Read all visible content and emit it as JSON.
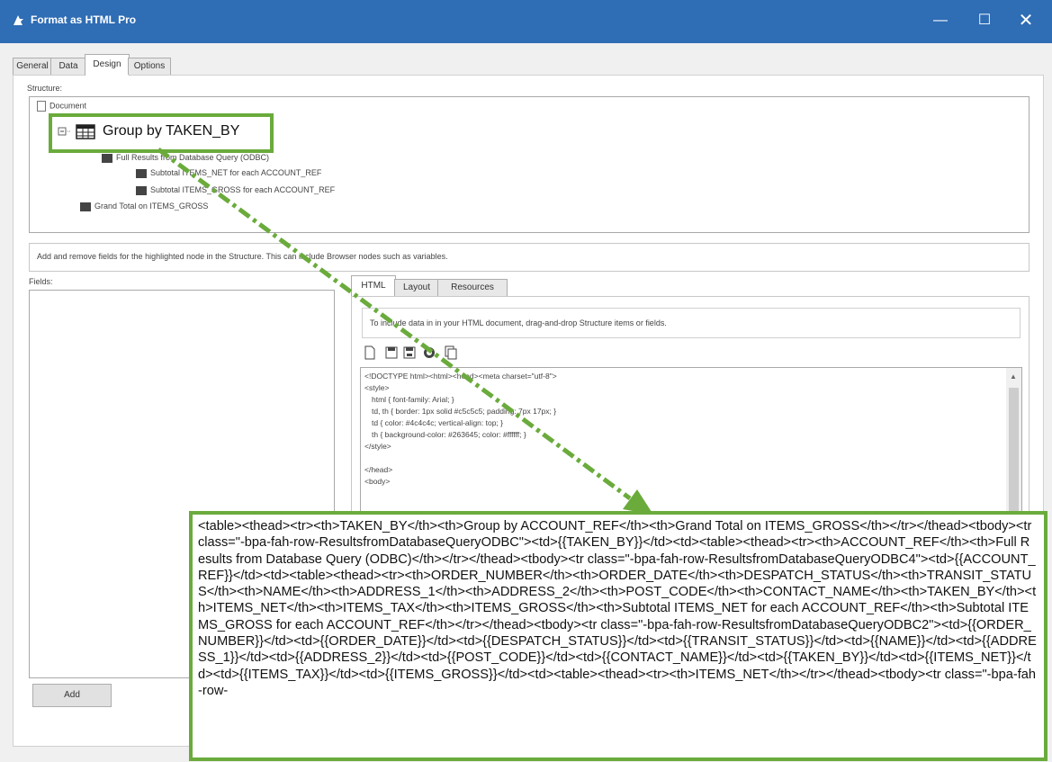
{
  "window": {
    "title": "Format as HTML Pro",
    "minimize": "—",
    "maximize": "☐",
    "close": "✕"
  },
  "tabs": [
    {
      "label": "General"
    },
    {
      "label": "Data"
    },
    {
      "label": "Design"
    },
    {
      "label": "Options"
    }
  ],
  "structure": {
    "label": "Structure:",
    "document": "Document",
    "group": "Group by TAKEN_BY",
    "full_results": "Full Results from Database Query (ODBC)",
    "subtotal_net": "Subtotal ITEMS_NET for each ACCOUNT_REF",
    "subtotal_gross": "Subtotal ITEMS_GROSS for each ACCOUNT_REF",
    "grand_total": "Grand Total on ITEMS_GROSS"
  },
  "hint": "Add and remove fields for the highlighted node in the Structure.  This can include Browser nodes such as variables.",
  "fields": {
    "label": "Fields:",
    "add_button": "Add"
  },
  "subtabs": [
    {
      "label": "HTML"
    },
    {
      "label": "Layout"
    },
    {
      "label": "Resources"
    }
  ],
  "info": "To include data in in your HTML document, drag-and-drop Structure items or fields.",
  "code_lines": [
    "<!DOCTYPE html><html><head><meta charset=\"utf-8\">",
    "<style>",
    "  html { font-family: Arial; }",
    "  td, th { border: 1px solid #c5c5c5; padding: 7px 17px; }",
    "  td { color: #4c4c4c; vertical-align: top; }",
    "  th { background-color: #263645; color: #ffffff; }",
    "</style>",
    "",
    "</head>",
    "<body>"
  ],
  "callout_code": "<table><thead><tr><th>TAKEN_BY</th><th>Group by ACCOUNT_REF</th><th>Grand Total on ITEMS_GROSS</th></tr></thead><tbody><tr class=\"-bpa-fah-row-ResultsfromDatabaseQueryODBC\"><td>{{TAKEN_BY}}</td><td><table><thead><tr><th>ACCOUNT_REF</th><th>Full Results from Database Query (ODBC)</th></tr></thead><tbody><tr class=\"-bpa-fah-row-ResultsfromDatabaseQueryODBC4\"><td>{{ACCOUNT_REF}}</td><td><table><thead><tr><th>ORDER_NUMBER</th><th>ORDER_DATE</th><th>DESPATCH_STATUS</th><th>TRANSIT_STATUS</th><th>NAME</th><th>ADDRESS_1</th><th>ADDRESS_2</th><th>POST_CODE</th><th>CONTACT_NAME</th><th>TAKEN_BY</th><th>ITEMS_NET</th><th>ITEMS_TAX</th><th>ITEMS_GROSS</th><th>Subtotal ITEMS_NET for each ACCOUNT_REF</th><th>Subtotal ITEMS_GROSS for each ACCOUNT_REF</th></tr></thead><tbody><tr class=\"-bpa-fah-row-ResultsfromDatabaseQueryODBC2\"><td>{{ORDER_NUMBER}}</td><td>{{ORDER_DATE}}</td><td>{{DESPATCH_STATUS}}</td><td>{{TRANSIT_STATUS}}</td><td>{{NAME}}</td><td>{{ADDRESS_1}}</td><td>{{ADDRESS_2}}</td><td>{{POST_CODE}}</td><td>{{CONTACT_NAME}}</td><td>{{TAKEN_BY}}</td><td>{{ITEMS_NET}}</td><td>{{ITEMS_TAX}}</td><td>{{ITEMS_GROSS}}</td><td><table><thead><tr><th>ITEMS_NET</th></tr></thead><tbody><tr class=\"-bpa-fah-row-",
  "colors": {
    "titlebar": "#2f6db5",
    "highlight": "#6aab3c"
  }
}
